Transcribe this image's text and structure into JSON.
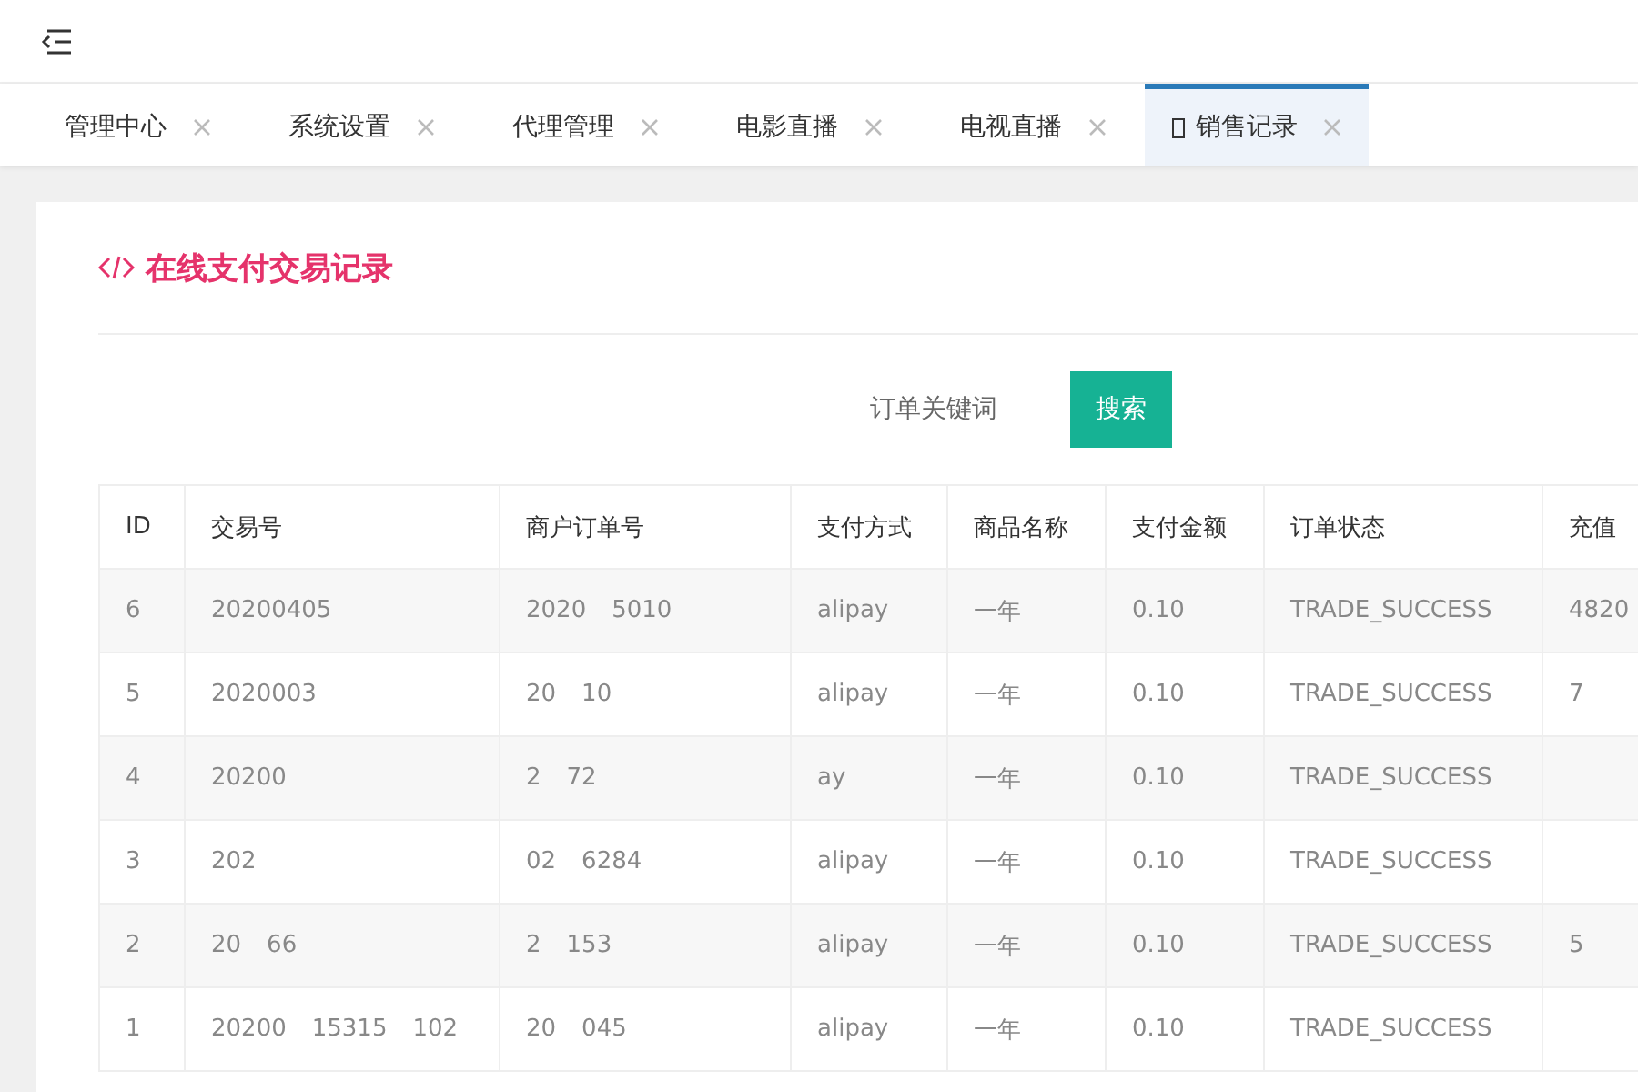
{
  "tabs": [
    {
      "label": "管理中心",
      "selected": false
    },
    {
      "label": "系统设置",
      "selected": false
    },
    {
      "label": "代理管理",
      "selected": false
    },
    {
      "label": "电影直播",
      "selected": false
    },
    {
      "label": "电视直播",
      "selected": false
    },
    {
      "label": "销售记录",
      "selected": true
    }
  ],
  "panel": {
    "title": "在线支付交易记录",
    "search_label": "订单关键词",
    "search_button": "搜索"
  },
  "table": {
    "columns": [
      "ID",
      "交易号",
      "商户订单号",
      "支付方式",
      "商品名称",
      "支付金额",
      "订单状态",
      "充值"
    ],
    "rows": [
      {
        "id": "6",
        "trade_no": "20200405",
        "order_no": "2020",
        "order_no_2": "5010",
        "method": "alipay",
        "product": "一年",
        "amount": "0.10",
        "status": "TRADE_SUCCESS",
        "card": "4820"
      },
      {
        "id": "5",
        "trade_no": "2020003",
        "order_no": "20",
        "order_no_2": "10",
        "method": "alipay",
        "product": "一年",
        "amount": "0.10",
        "status": "TRADE_SUCCESS",
        "card": "7"
      },
      {
        "id": "4",
        "trade_no": "20200",
        "order_no": "2",
        "order_no_2": "72",
        "method": "ay",
        "product": "一年",
        "amount": "0.10",
        "status": "TRADE_SUCCESS"
      },
      {
        "id": "3",
        "trade_no": "202",
        "order_no": "02",
        "order_no_2": "6284",
        "method": "alipay",
        "product": "一年",
        "amount": "0.10",
        "status": "TRADE_SUCCESS"
      },
      {
        "id": "2",
        "trade_no": "20",
        "trade_no_2": "66",
        "order_no": "2",
        "order_no_2": "153",
        "method": "alipay",
        "product": "一年",
        "amount": "0.10",
        "status": "TRADE_SUCCESS",
        "card": "5"
      },
      {
        "id": "1",
        "trade_no": "20200",
        "trade_no_2": "15315",
        "trade_no_3": "102",
        "order_no": "20",
        "order_no_2": "045",
        "method": "alipay",
        "product": "一年",
        "amount": "0.10",
        "status": "TRADE_SUCCESS"
      }
    ]
  }
}
